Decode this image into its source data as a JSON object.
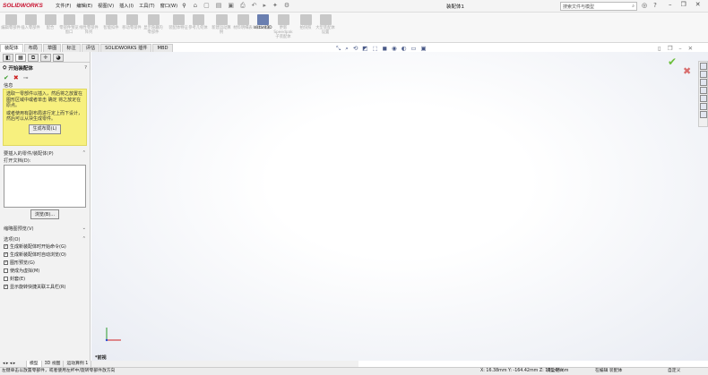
{
  "app": {
    "logo": "SOLIDWORKS",
    "document_title": "装配体1"
  },
  "menu": [
    "文件(F)",
    "编辑(E)",
    "视图(V)",
    "插入(I)",
    "工具(T)",
    "窗口(W)"
  ],
  "search": {
    "placeholder": "搜索文件与模型"
  },
  "command_buttons": [
    {
      "label": "编辑零部件"
    },
    {
      "label": "插入零部件"
    },
    {
      "label": "配合"
    },
    {
      "label": "零部件预览窗口"
    },
    {
      "label": "线性零部件阵列"
    },
    {
      "label": "智能扣件"
    },
    {
      "label": "移动零部件"
    },
    {
      "label": "显示隐藏的零部件"
    },
    {
      "label": "装配体特征"
    },
    {
      "label": "参考几何体"
    },
    {
      "label": "新建运动算例"
    },
    {
      "label": "材料明细表"
    },
    {
      "label": "爆炸视图"
    },
    {
      "label": "Instant3D",
      "active": true
    },
    {
      "label": "更新Speedpak子装配体"
    },
    {
      "label": "拍快照"
    },
    {
      "label": "大型装配体设置"
    }
  ],
  "tabs": [
    "装配体",
    "布局",
    "草图",
    "标注",
    "评估",
    "SOLIDWORKS 插件",
    "MBD"
  ],
  "panel": {
    "title": "开始装配体",
    "info_header": "信息",
    "info_text1": "选取一零部件以插入，然后将之放置在图形区域中或者单击 确定 将之放定在原点。",
    "info_text2": "或者使用有副布局进行定上而下设计，然后可以从块生成零件。",
    "layout_button": "生成布局(L)",
    "parts_header": "要插入的零件/装配体(P)",
    "open_docs": "打开文档(D):",
    "browse_button": "浏览(B)...",
    "thumbnail_header": "缩略图预览(V)",
    "options_header": "选项(O)",
    "options": [
      {
        "label": "生成新装配体时开始命令(G)",
        "checked": true
      },
      {
        "label": "生成新装配体时自动浏览(O)",
        "checked": true
      },
      {
        "label": "图形预览(G)",
        "checked": true
      },
      {
        "label": "使成为虚拟(M)",
        "checked": false
      },
      {
        "label": "封套(E)",
        "checked": false
      },
      {
        "label": "显示旋转快捷关联工具栏(R)",
        "checked": true
      }
    ]
  },
  "viewport": {
    "view_label": "*前视"
  },
  "bottom_tabs": [
    "模型",
    "3D 视图",
    "运动算例 1"
  ],
  "status": {
    "hint": "左键单击以放置零部件，或者使用左杯中/旋转零部件放方向",
    "coords": "X: 16.38mm Y: -164.42mm Z: 181.44mm",
    "defined": "完全定义",
    "editing": "在编辑 装配体",
    "custom": "自定义"
  }
}
